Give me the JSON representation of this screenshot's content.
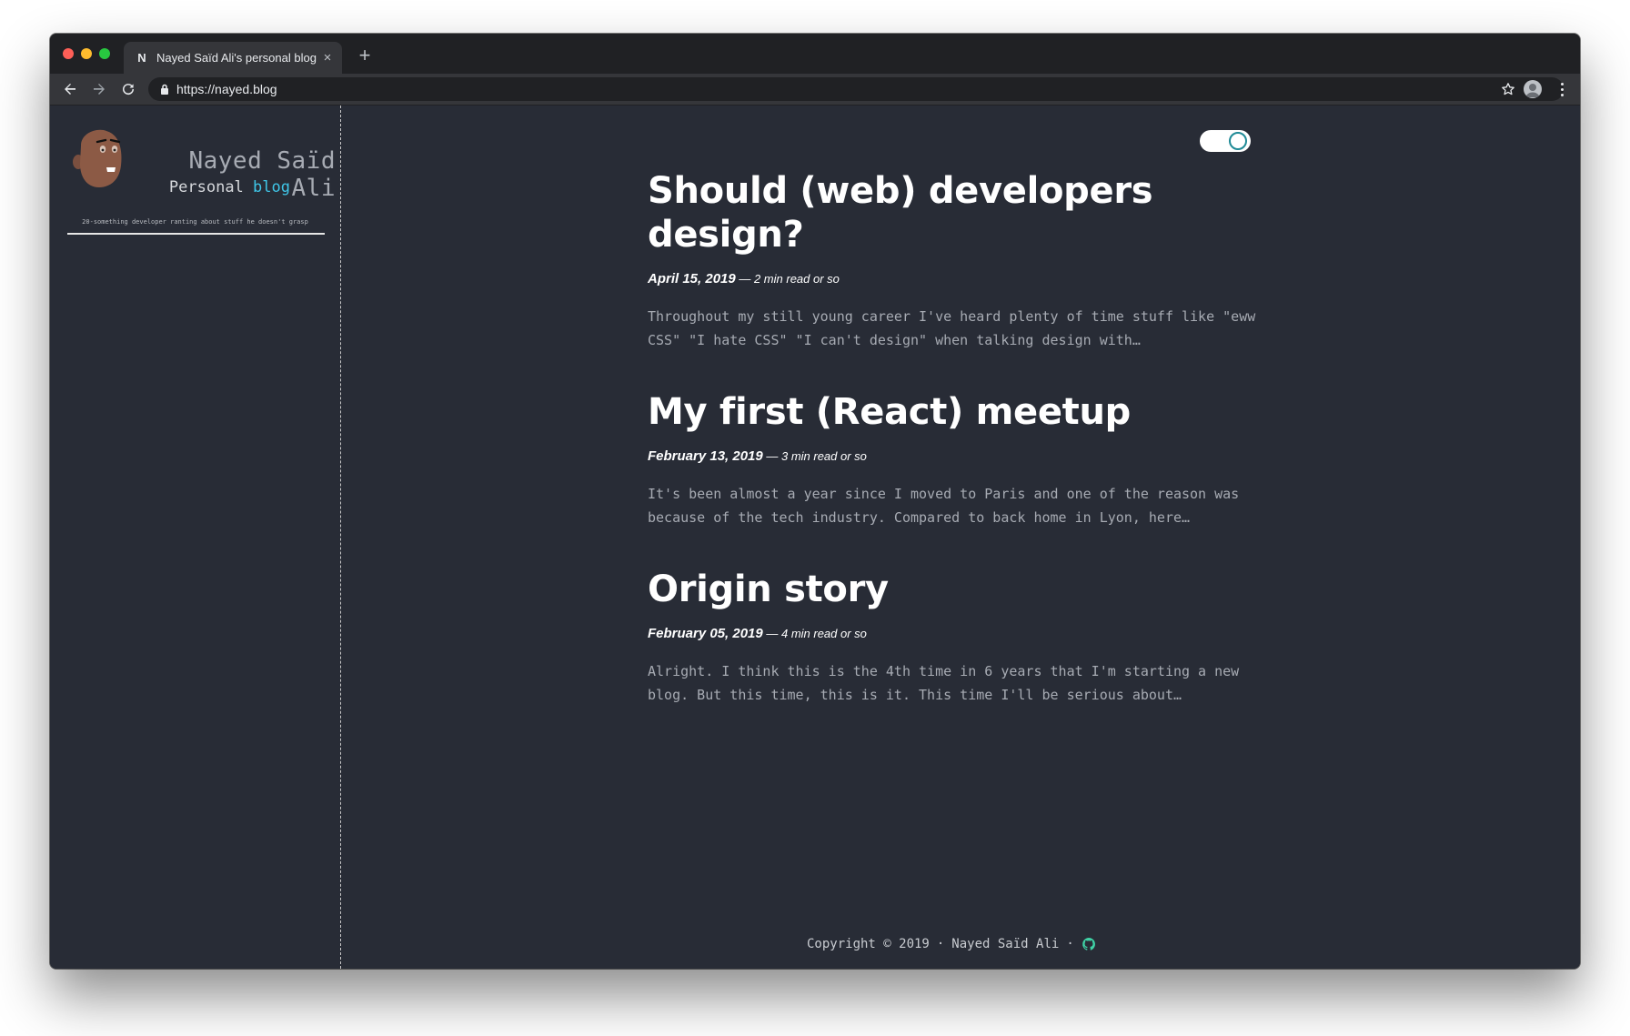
{
  "browser": {
    "tab_title": "Nayed Saïd Ali's personal blog",
    "tab_favicon": "N",
    "url_scheme": "https://",
    "url_host": "nayed.blog",
    "new_tab_label": "+",
    "tab_close_label": "×"
  },
  "sidebar": {
    "name": "Nayed Saïd Ali",
    "subtitle_prefix": "Personal",
    "subtitle_highlight": "blog",
    "tagline": "20-something developer ranting about stuff he doesn't grasp"
  },
  "posts": [
    {
      "title": "Should (web) developers design?",
      "date": "April 15, 2019",
      "read_time": " — 2 min read or so",
      "excerpt": "Throughout my still young career I've heard plenty of time stuff like \"eww CSS\" \"I hate CSS\" \"I can't design\" when talking design with…"
    },
    {
      "title": "My first (React) meetup",
      "date": "February 13, 2019",
      "read_time": " — 3 min read or so",
      "excerpt": "It's been almost a year since I moved to Paris and one of the reason was because of the tech industry. Compared to back home in Lyon, here…"
    },
    {
      "title": "Origin story",
      "date": "February 05, 2019",
      "read_time": " — 4 min read or so",
      "excerpt": "Alright. I think this is the 4th time in 6 years that I'm starting a new blog. But this time, this is it. This time I'll be serious about…"
    }
  ],
  "footer": {
    "copyright": "Copyright © 2019",
    "separator": "·",
    "author": "Nayed Saïd Ali"
  },
  "colors": {
    "background": "#282c36",
    "accent": "#3fc6e8",
    "toggle_knob": "#1f8a96",
    "github_icon": "#3fd1a5"
  },
  "theme_toggle": {
    "state": "on"
  }
}
